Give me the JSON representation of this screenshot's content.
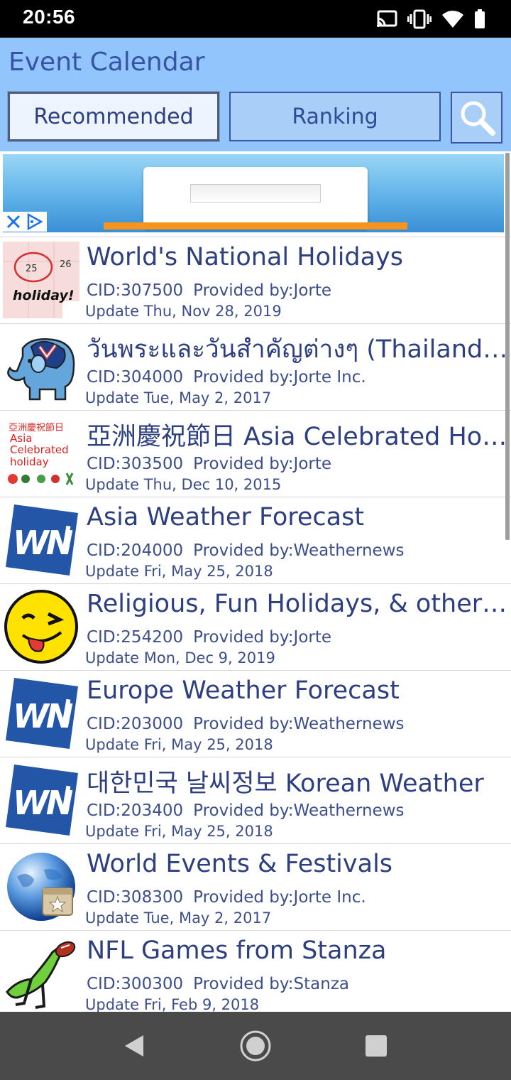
{
  "status_bar": {
    "time": "20:56",
    "icons": [
      "cast-icon",
      "vibrate-icon",
      "wifi-icon",
      "battery-icon"
    ]
  },
  "app": {
    "title": "Event Calendar",
    "tabs": [
      {
        "label": "Recommended",
        "active": true
      },
      {
        "label": "Ranking",
        "active": false
      }
    ],
    "search_icon": "search-icon"
  },
  "ad": {
    "close_icons": [
      "close-icon",
      "adchoices-icon"
    ]
  },
  "calendars": [
    {
      "name": "World's National Holidays",
      "cid": "CID:307500",
      "provider": "Provided by:Jorte",
      "updated": "Update Thu, Nov 28, 2019",
      "icon": "holiday-calendar-icon",
      "icon_text": "holiday!",
      "icon_nums": [
        "25",
        "26"
      ]
    },
    {
      "name": "วันพระและวันสำคัญต่างๆ (Thailand S...",
      "cid": "CID:304000",
      "provider": "Provided by:Jorte Inc.",
      "updated": "Update Tue, May 2, 2017",
      "icon": "elephant-icon"
    },
    {
      "name": "亞洲慶祝節日 Asia Celebrated Holid...",
      "cid": "CID:303500",
      "provider": "Provided by:Jorte",
      "updated": "Update Thu, Dec 10, 2015",
      "icon": "asia-holiday-icon",
      "icon_lines": [
        "亞洲慶祝節日",
        "Asia",
        "Celebrated",
        "holiday"
      ]
    },
    {
      "name": "Asia Weather Forecast",
      "cid": "CID:204000",
      "provider": "Provided by:Weathernews",
      "updated": "Update Fri, May 25, 2018",
      "icon": "weathernews-logo-icon"
    },
    {
      "name": "Religious, Fun Holidays, & other Cal...",
      "cid": "CID:254200",
      "provider": "Provided by:Jorte",
      "updated": "Update Mon, Dec 9, 2019",
      "icon": "winking-smiley-icon"
    },
    {
      "name": "Europe Weather Forecast",
      "cid": "CID:203000",
      "provider": "Provided by:Weathernews",
      "updated": "Update Fri, May 25, 2018",
      "icon": "weathernews-logo-icon"
    },
    {
      "name": "대한민국 날씨정보 Korean Weather",
      "cid": "CID:203400",
      "provider": "Provided by:Weathernews",
      "updated": "Update Fri, May 25, 2018",
      "icon": "weathernews-logo-icon"
    },
    {
      "name": "World Events & Festivals",
      "cid": "CID:308300",
      "provider": "Provided by:Jorte Inc.",
      "updated": "Update Tue, May 2, 2017",
      "icon": "globe-calendar-icon"
    },
    {
      "name": "NFL Games from Stanza",
      "cid": "CID:300300",
      "provider": "Provided by:Stanza",
      "updated": "Update Fri, Feb 9, 2018",
      "icon": "frog-football-icon"
    }
  ],
  "nav_bar": {
    "buttons": [
      "back-icon",
      "home-icon",
      "recents-icon"
    ]
  },
  "colors": {
    "appbar": "#91c5fb",
    "title": "#3653a6",
    "text": "#2d3f80",
    "navbar": "#4a4a4a"
  }
}
